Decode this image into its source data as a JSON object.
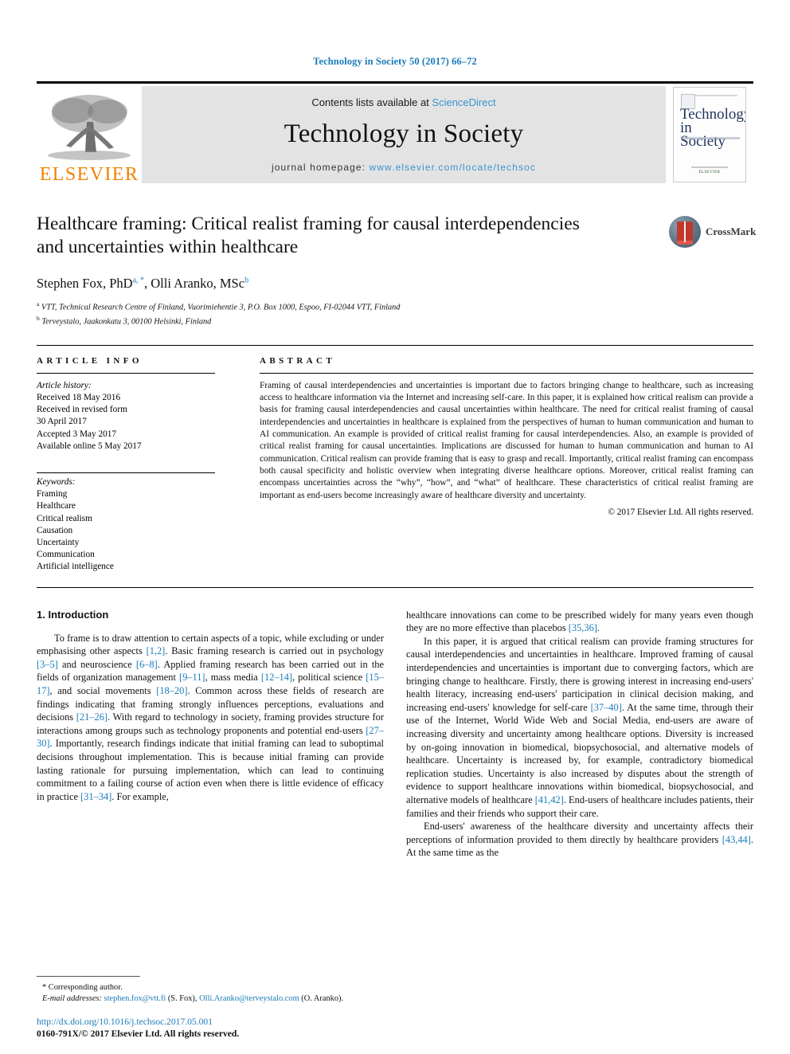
{
  "running_head": "Technology in Society 50 (2017) 66–72",
  "masthead": {
    "publisher_name": "ELSEVIER",
    "contents_prefix": "Contents lists available at ",
    "contents_link": "ScienceDirect",
    "journal_name": "Technology in Society",
    "homepage_prefix": "journal homepage: ",
    "homepage_url": "www.elsevier.com/locate/techsoc",
    "cover": {
      "title_line1": "Technology",
      "title_line2": "in Society",
      "footer": "ELSEVIER"
    }
  },
  "article": {
    "title": "Healthcare framing: Critical realist framing for causal interdependencies and uncertainties within healthcare",
    "authors": "Stephen Fox, PhD , Olli Aranko, MSc",
    "author_1_name": "Stephen Fox, PhD",
    "author_1_marks": "a, *",
    "author_2_name": "Olli Aranko, MSc",
    "author_2_marks": "b",
    "affiliation_a": "VTT, Technical Research Centre of Finland, Vuorimiehentie 3, P.O. Box 1000, Espoo, FI-02044 VTT, Finland",
    "affiliation_b": "Terveystalo, Jaakonkatu 3, 00100 Helsinki, Finland",
    "crossmark_label": "CrossMark"
  },
  "article_info": {
    "heading": "ARTICLE INFO",
    "history_label": "Article history:",
    "history": [
      "Received 18 May 2016",
      "Received in revised form",
      "30 April 2017",
      "Accepted 3 May 2017",
      "Available online 5 May 2017"
    ],
    "keywords_label": "Keywords:",
    "keywords": [
      "Framing",
      "Healthcare",
      "Critical realism",
      "Causation",
      "Uncertainty",
      "Communication",
      "Artificial intelligence"
    ]
  },
  "abstract": {
    "heading": "ABSTRACT",
    "text": "Framing of causal interdependencies and uncertainties is important due to factors bringing change to healthcare, such as increasing access to healthcare information via the Internet and increasing self-care. In this paper, it is explained how critical realism can provide a basis for framing causal interdependencies and causal uncertainties within healthcare. The need for critical realist framing of causal interdependencies and uncertainties in healthcare is explained from the perspectives of human to human communication and human to AI communication. An example is provided of critical realist framing for causal interdependencies. Also, an example is provided of critical realist framing for causal uncertainties. Implications are discussed for human to human communication and human to AI communication. Critical realism can provide framing that is easy to grasp and recall. Importantly, critical realist framing can encompass both causal specificity and holistic overview when integrating diverse healthcare options. Moreover, critical realist framing can encompass uncertainties across the “why”, “how”, and “what” of healthcare. These characteristics of critical realist framing are important as end-users become increasingly aware of healthcare diversity and uncertainty.",
    "rights": "© 2017 Elsevier Ltd. All rights reserved."
  },
  "body": {
    "section_number_title": "1. Introduction",
    "left_paragraph_1_a": "To frame is to draw attention to certain aspects of a topic, while excluding or under emphasising other aspects ",
    "left_ref_1": "[1,2]",
    "left_paragraph_1_b": ". Basic framing research is carried out in psychology ",
    "left_ref_2": "[3–5]",
    "left_paragraph_1_c": " and neuroscience ",
    "left_ref_3": "[6–8]",
    "left_paragraph_1_d": ". Applied framing research has been carried out in the fields of organization management ",
    "left_ref_4": "[9–11]",
    "left_paragraph_1_e": ", mass media ",
    "left_ref_5": "[12–14]",
    "left_paragraph_1_f": ", political science ",
    "left_ref_6": "[15–17]",
    "left_paragraph_1_g": ", and social movements ",
    "left_ref_7": "[18–20]",
    "left_paragraph_1_h": ". Common across these fields of research are findings indicating that framing strongly influences perceptions, evaluations and decisions ",
    "left_ref_8": "[21–26]",
    "left_paragraph_1_i": ". With regard to technology in society, framing provides structure for interactions among groups such as technology proponents and potential end-users ",
    "left_ref_9": "[27–30]",
    "left_paragraph_1_j": ". Importantly, research findings indicate that initial framing can lead to suboptimal decisions throughout implementation. This is because initial framing can provide lasting rationale for pursuing implementation, which can lead to continuing commitment to a failing course of action even when there is little evidence of efficacy in practice ",
    "left_ref_10": "[31–34]",
    "left_paragraph_1_k": ". For example,",
    "right_paragraph_1_a": "healthcare innovations can come to be prescribed widely for many years even though they are no more effective than placebos ",
    "right_ref_1": "[35,36]",
    "right_paragraph_1_b": ".",
    "right_paragraph_2_a": "In this paper, it is argued that critical realism can provide framing structures for causal interdependencies and uncertainties in healthcare. Improved framing of causal interdependencies and uncertainties is important due to converging factors, which are bringing change to healthcare. Firstly, there is growing interest in increasing end-users' health literacy, increasing end-users' participation in clinical decision making, and increasing end-users' knowledge for self-care ",
    "right_ref_2": "[37–40]",
    "right_paragraph_2_b": ". At the same time, through their use of the Internet, World Wide Web and Social Media, end-users are aware of increasing diversity and uncertainty among healthcare options. Diversity is increased by on-going innovation in biomedical, biopsychosocial, and alternative models of healthcare. Uncertainty is increased by, for example, contradictory biomedical replication studies. Uncertainty is also increased by disputes about the strength of evidence to support healthcare innovations within biomedical, biopsychosocial, and alternative models of healthcare ",
    "right_ref_3": "[41,42]",
    "right_paragraph_2_c": ". End-users of healthcare includes patients, their families and their friends who support their care.",
    "right_paragraph_3_a": "End-users' awareness of the healthcare diversity and uncertainty affects their perceptions of information provided to them directly by healthcare providers ",
    "right_ref_4": "[43,44]",
    "right_paragraph_3_b": ". At the same time as the"
  },
  "footnote": {
    "corresponding": "Corresponding author.",
    "email_label": "E-mail addresses:",
    "email_1": "stephen.fox@vtt.fi",
    "email_1_owner": "(S. Fox),",
    "email_2": "Olli.Aranko@terveystalo.com",
    "email_2_owner": "(O. Aranko)."
  },
  "imprint": {
    "doi": "http://dx.doi.org/10.1016/j.techsoc.2017.05.001",
    "issn_line": "0160-791X/© 2017 Elsevier Ltd. All rights reserved."
  }
}
